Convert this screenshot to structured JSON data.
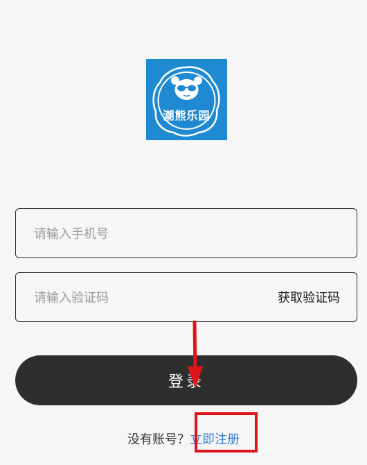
{
  "logo": {
    "text": "潮熊乐园",
    "bg_color": "#1f8ad1",
    "icon": "panda-with-sunglasses-icon"
  },
  "phone_field": {
    "placeholder": "请输入手机号",
    "value": ""
  },
  "code_field": {
    "placeholder": "请输入验证码",
    "value": "",
    "get_code_label": "获取验证码"
  },
  "login_button": {
    "label": "登录"
  },
  "register": {
    "prompt": "没有账号？",
    "link_label": "立即注册"
  },
  "colors": {
    "button_bg": "#2e2e2e",
    "link": "#3a7fd8",
    "annotation": "#e0141b"
  }
}
